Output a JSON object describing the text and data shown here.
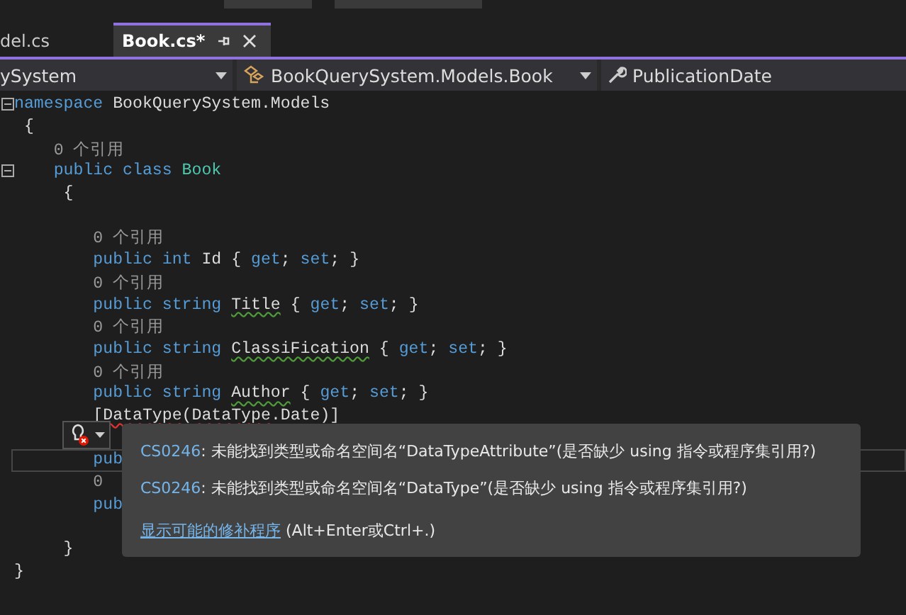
{
  "tabs": [
    {
      "label": "del.cs",
      "selected": false
    },
    {
      "label": "Book.cs*",
      "selected": true
    }
  ],
  "nav_bar": [
    {
      "label": "ySystem",
      "kind": "project"
    },
    {
      "label": "BookQuerySystem.Models.Book",
      "kind": "class"
    },
    {
      "label": "PublicationDate",
      "kind": "member"
    }
  ],
  "code_lines": [
    {
      "kind": "code",
      "fold": true,
      "tokens": [
        {
          "text": "namespace",
          "kind": "keyword"
        },
        {
          "text": " BookQuerySystem.Models",
          "kind": "plain"
        }
      ]
    },
    {
      "kind": "code",
      "tokens": [
        {
          "text": " {",
          "kind": "plain"
        }
      ]
    },
    {
      "kind": "code",
      "tokens": [
        {
          "text": "    0 个引用",
          "kind": "lens"
        }
      ]
    },
    {
      "kind": "code",
      "fold": true,
      "tokens": [
        {
          "text": "    public class ",
          "kind": "keyword"
        },
        {
          "text": "Book",
          "kind": "type"
        }
      ]
    },
    {
      "kind": "code",
      "tokens": [
        {
          "text": "     {",
          "kind": "plain"
        }
      ]
    },
    {
      "kind": "blank"
    },
    {
      "kind": "code",
      "tokens": [
        {
          "text": "        0 个引用",
          "kind": "lens"
        }
      ]
    },
    {
      "kind": "code",
      "tokens": [
        {
          "text": "        public int",
          "kind": "keyword"
        },
        {
          "text": " Id { ",
          "kind": "plain"
        },
        {
          "text": "get",
          "kind": "keyword"
        },
        {
          "text": "; ",
          "kind": "plain"
        },
        {
          "text": "set",
          "kind": "keyword"
        },
        {
          "text": "; }",
          "kind": "plain"
        }
      ]
    },
    {
      "kind": "code",
      "tokens": [
        {
          "text": "        0 个引用",
          "kind": "lens"
        }
      ]
    },
    {
      "kind": "code",
      "tokens": [
        {
          "text": "        public string ",
          "kind": "keyword"
        },
        {
          "text": "Title",
          "kind": "warning"
        },
        {
          "text": " { ",
          "kind": "plain"
        },
        {
          "text": "get",
          "kind": "keyword"
        },
        {
          "text": "; ",
          "kind": "plain"
        },
        {
          "text": "set",
          "kind": "keyword"
        },
        {
          "text": "; }",
          "kind": "plain"
        }
      ]
    },
    {
      "kind": "code",
      "tokens": [
        {
          "text": "        0 个引用",
          "kind": "lens"
        }
      ]
    },
    {
      "kind": "code",
      "tokens": [
        {
          "text": "        public string ",
          "kind": "keyword"
        },
        {
          "text": "ClassiFication",
          "kind": "warning"
        },
        {
          "text": " { ",
          "kind": "plain"
        },
        {
          "text": "get",
          "kind": "keyword"
        },
        {
          "text": "; ",
          "kind": "plain"
        },
        {
          "text": "set",
          "kind": "keyword"
        },
        {
          "text": "; }",
          "kind": "plain"
        }
      ]
    },
    {
      "kind": "code",
      "tokens": [
        {
          "text": "        0 个引用",
          "kind": "lens"
        }
      ]
    },
    {
      "kind": "code",
      "tokens": [
        {
          "text": "        public string ",
          "kind": "keyword"
        },
        {
          "text": "Author",
          "kind": "warning"
        },
        {
          "text": " { ",
          "kind": "plain"
        },
        {
          "text": "get",
          "kind": "keyword"
        },
        {
          "text": "; ",
          "kind": "plain"
        },
        {
          "text": "set",
          "kind": "keyword"
        },
        {
          "text": "; }",
          "kind": "plain"
        }
      ]
    },
    {
      "kind": "code",
      "tokens": [
        {
          "text": "        [",
          "kind": "plain"
        },
        {
          "text": "DataType",
          "kind": "error"
        },
        {
          "text": "(",
          "kind": "plain"
        },
        {
          "text": "DataType",
          "kind": "error"
        },
        {
          "text": ".Date)]",
          "kind": "plain"
        }
      ]
    },
    {
      "kind": "blank"
    },
    {
      "kind": "code",
      "current": true,
      "tokens": [
        {
          "text": "        pub",
          "kind": "keyword"
        }
      ]
    },
    {
      "kind": "code",
      "tokens": [
        {
          "text": "        0",
          "kind": "lens"
        }
      ]
    },
    {
      "kind": "code",
      "tokens": [
        {
          "text": "        pub",
          "kind": "keyword"
        }
      ]
    },
    {
      "kind": "blank"
    },
    {
      "kind": "code",
      "tokens": [
        {
          "text": "     }",
          "kind": "plain"
        }
      ]
    },
    {
      "kind": "code",
      "tokens": [
        {
          "text": "}",
          "kind": "plain"
        }
      ]
    }
  ],
  "quick_info": {
    "errors": [
      {
        "code": "CS0246",
        "message": ": 未能找到类型或命名空间名“DataTypeAttribute”(是否缺少 using 指令或程序集引用?)"
      },
      {
        "code": "CS0246",
        "message": ": 未能找到类型或命名空间名“DataType”(是否缺少 using 指令或程序集引用?)"
      }
    ],
    "fix_link": "显示可能的修补程序",
    "shortcut": " (Alt+Enter或Ctrl+.)"
  }
}
